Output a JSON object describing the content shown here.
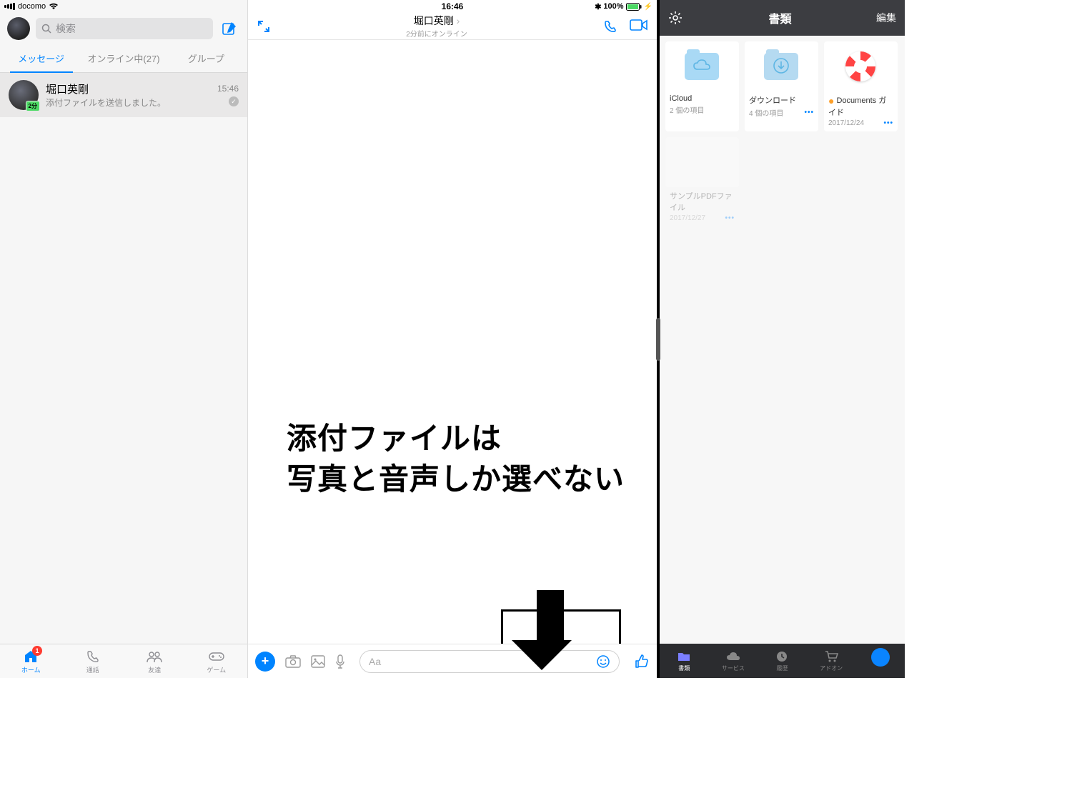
{
  "status": {
    "carrier": "docomo",
    "time": "16:46",
    "battery": "100%"
  },
  "left": {
    "search_placeholder": "検索",
    "tabs": {
      "messages": "メッセージ",
      "online": "オンライン中(27)",
      "groups": "グループ"
    },
    "convo": {
      "name": "堀口英剛",
      "sub": "添付ファイルを送信しました。",
      "time": "15:46",
      "badge": "2分"
    },
    "tabbar": {
      "home": "ホーム",
      "calls": "通話",
      "friends": "友達",
      "games": "ゲーム",
      "home_badge": "1"
    }
  },
  "center": {
    "title": "堀口英剛",
    "subtitle": "2分前にオンライン",
    "annotation_line1": "添付ファイルは",
    "annotation_line2": "写真と音声しか選べない",
    "input_placeholder": "Aa"
  },
  "right": {
    "title": "書類",
    "edit": "編集",
    "items": [
      {
        "name": "iCloud",
        "meta": "2 個の項目"
      },
      {
        "name": "ダウンロード",
        "meta": "4 個の項目"
      },
      {
        "name": "Documents ガイド",
        "meta": "2017/12/24"
      },
      {
        "name": "サンプルPDFファイル",
        "meta": "2017/12/27"
      }
    ],
    "tabbar": {
      "docs": "書類",
      "services": "サービス",
      "history": "履歴",
      "addons": "アドオン"
    }
  }
}
